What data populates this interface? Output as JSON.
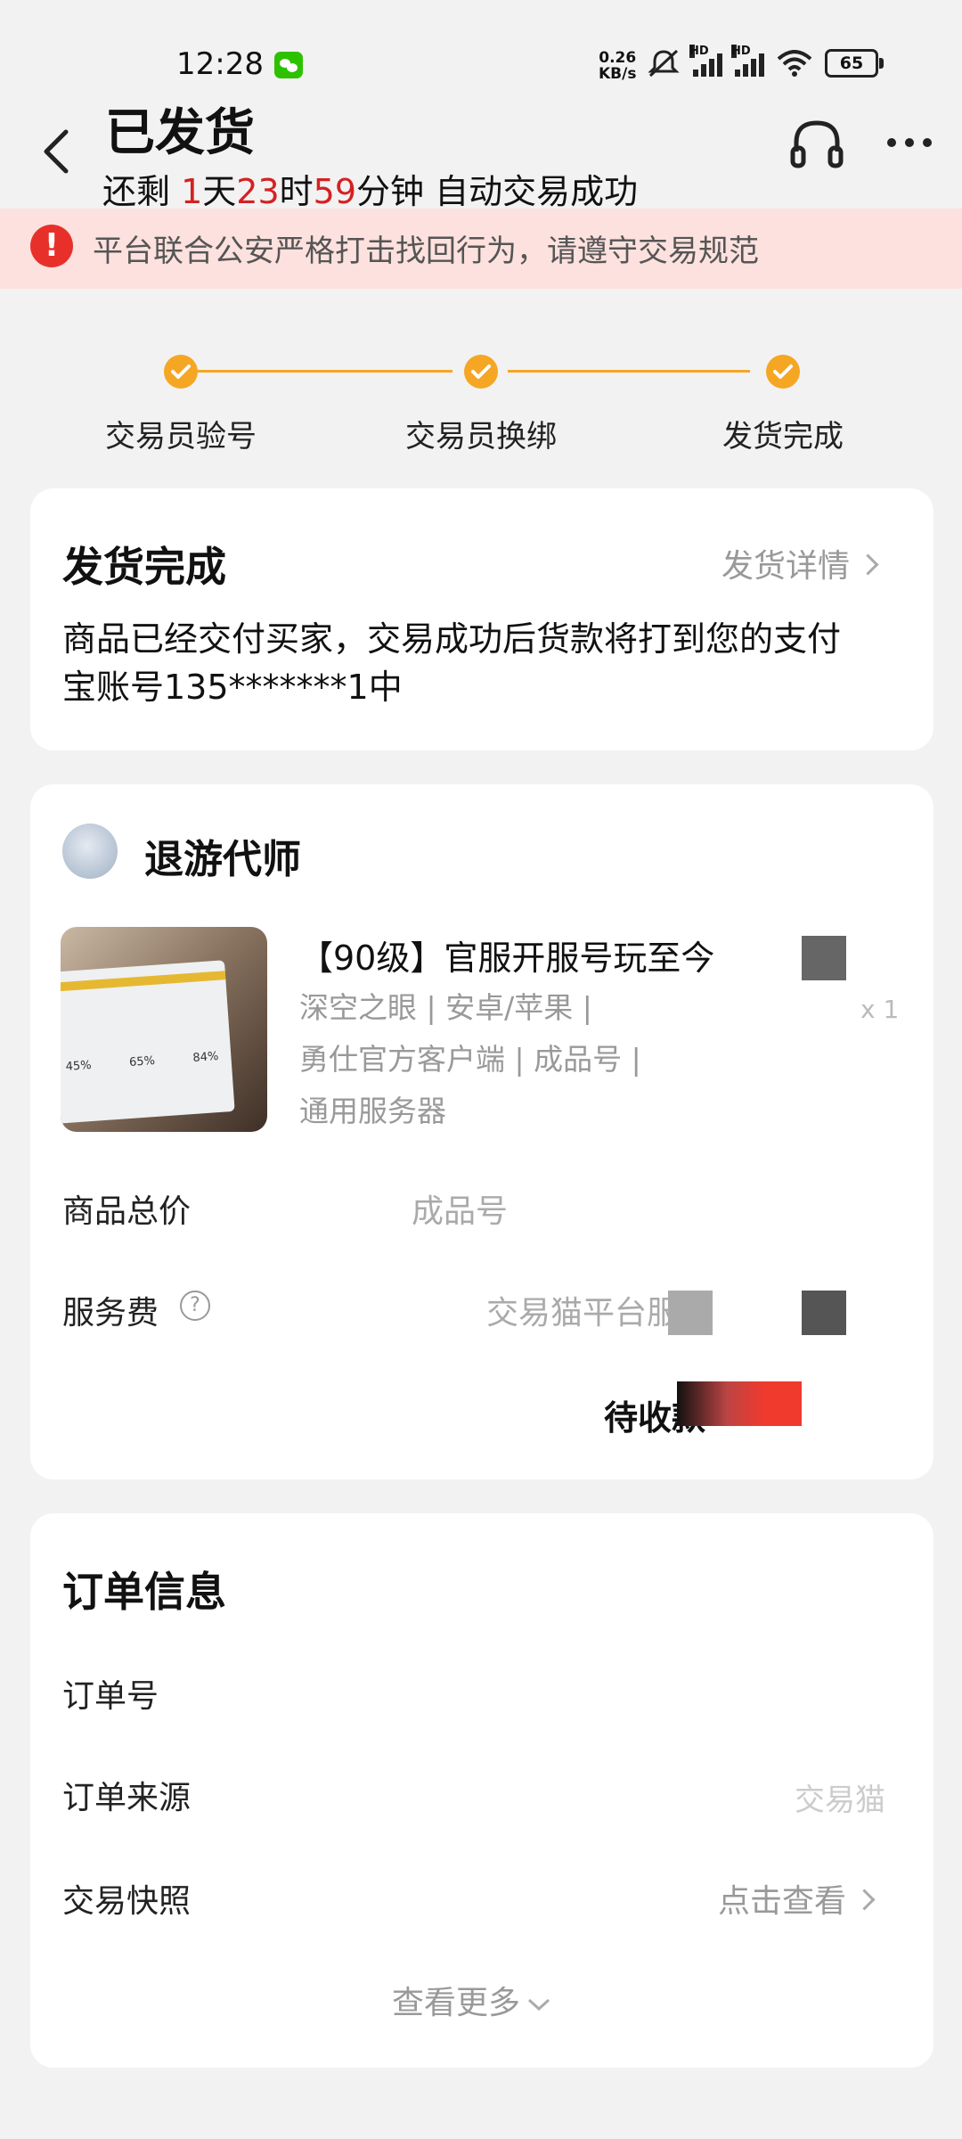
{
  "status_bar": {
    "time": "12:28",
    "net_speed_value": "0.26",
    "net_speed_unit": "KB/s",
    "hd1": "HD",
    "hd2": "HD",
    "battery": "65"
  },
  "header": {
    "title": "已发货",
    "countdown": {
      "prefix": "还剩 ",
      "days": "1",
      "days_unit": "天",
      "hours": "23",
      "hours_unit": "时",
      "minutes": "59",
      "minutes_unit": "分钟 ",
      "suffix": "自动交易成功"
    }
  },
  "warning": {
    "icon": "!",
    "text": "平台联合公安严格打击找回行为，请遵守交易规范"
  },
  "steps": [
    {
      "label": "交易员验号",
      "done": true
    },
    {
      "label": "交易员换绑",
      "done": true
    },
    {
      "label": "发货完成",
      "done": true
    }
  ],
  "delivery_card": {
    "title": "发货完成",
    "details_link": "发货详情",
    "desc_line1": "商品已经交付买家，交易成功后货款将打到您的支付",
    "desc_line2": "宝账号135*******1中"
  },
  "product_card": {
    "seller_name": "退游代师",
    "product_title": "【90级】官服开服号玩至今",
    "tags_line1": "深空之眼 | 安卓/苹果 |",
    "tags_line2": "勇仕官方客户端 | 成品号 |",
    "tags_line3": "通用服务器",
    "quantity": "x 1",
    "thumb_stats": [
      "45%",
      "65%",
      "84%"
    ],
    "total_label": "商品总价",
    "total_value_label": "成品号",
    "fee_label": "服务费",
    "fee_help": "?",
    "fee_value_label": "交易猫平台服",
    "pending_label": "待收款"
  },
  "order_card": {
    "title": "订单信息",
    "order_no_label": "订单号",
    "source_label": "订单来源",
    "source_value": "交易猫",
    "snapshot_label": "交易快照",
    "snapshot_link": "点击查看",
    "more_label": "查看更多"
  },
  "colors": {
    "accent": "#f5a623",
    "danger": "#d52121",
    "warning_bg": "#fde1de",
    "page_bg": "#f2f2f2"
  }
}
